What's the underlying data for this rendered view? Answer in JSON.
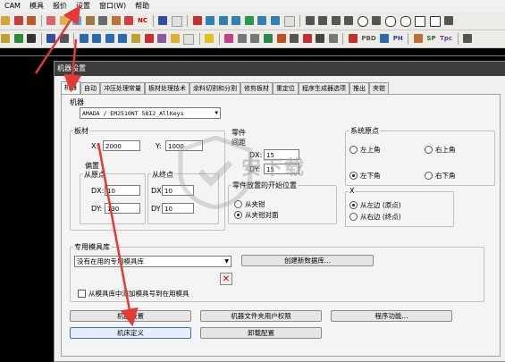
{
  "menubar": {
    "items": [
      "CAM",
      "模具",
      "报价",
      "设置",
      "窗口(W)",
      "帮助"
    ]
  },
  "toolbar": {
    "nc_label": "NC",
    "pbd_label": "PBD",
    "ph_label": "PH",
    "sp_label": "SP",
    "tpc_label": "Tpc"
  },
  "dialog": {
    "title": "机器设置",
    "tabs": [
      "机器",
      "自动",
      "冲压处理常量",
      "板材处理技术",
      "余料切割和分割",
      "修剪板材",
      "重定位",
      "程序生成器选项",
      "推出",
      "夹钳"
    ],
    "machine_label": "机器",
    "machine_value": "AMADA / EM2510NT  58I2_AllKeys",
    "sheet": {
      "label": "板材",
      "x_label": "X:",
      "x_value": "2000",
      "y_label": "Y:",
      "y_value": "1000",
      "offset_label": "偏置",
      "from_origin_label": "从原点",
      "from_end_label": "从终点",
      "dx_label": "DX:",
      "dx_value": "10",
      "dx2_label": "DX",
      "dx2_value": "10",
      "dy_label": "DY:",
      "dy_value": "130",
      "dy2_label": "DY",
      "dy2_value": "10"
    },
    "parts": {
      "label": "零件",
      "spacing_label": "间距",
      "dx_label": "DX:",
      "dx_value": "15",
      "dy_label": "DY:",
      "dy_value": "15",
      "start_label": "零件放置的开始位置",
      "opt1": "从夹钳",
      "opt2": "从夹钳对面"
    },
    "origin": {
      "label": "系统原点",
      "top_left": "左上角",
      "top_right": "右上角",
      "bottom_left": "左下角",
      "bottom_right": "右下角"
    },
    "xgroup": {
      "label": "X",
      "opt1": "从左边 (原点)",
      "opt2": "从右边 (终点)"
    },
    "tooling": {
      "label": "专用模具库",
      "select_value": "没有在用的专用模具库",
      "create_button": "创建新数据库...",
      "checkbox_label": "从模具库中添加模具号到在用模具"
    },
    "buttons": {
      "machine_settings": "机器设置",
      "user_rights": "机器文件夹用户权限",
      "program_functions": "程序功能...",
      "machine_definition": "机床定义",
      "uninstall_config": "卸载配置"
    }
  },
  "watermark": {
    "text": "安下载",
    "url": "anxz.com"
  },
  "colors": {
    "arrow": "#e53935",
    "titlebar": "#3c3c3c"
  }
}
